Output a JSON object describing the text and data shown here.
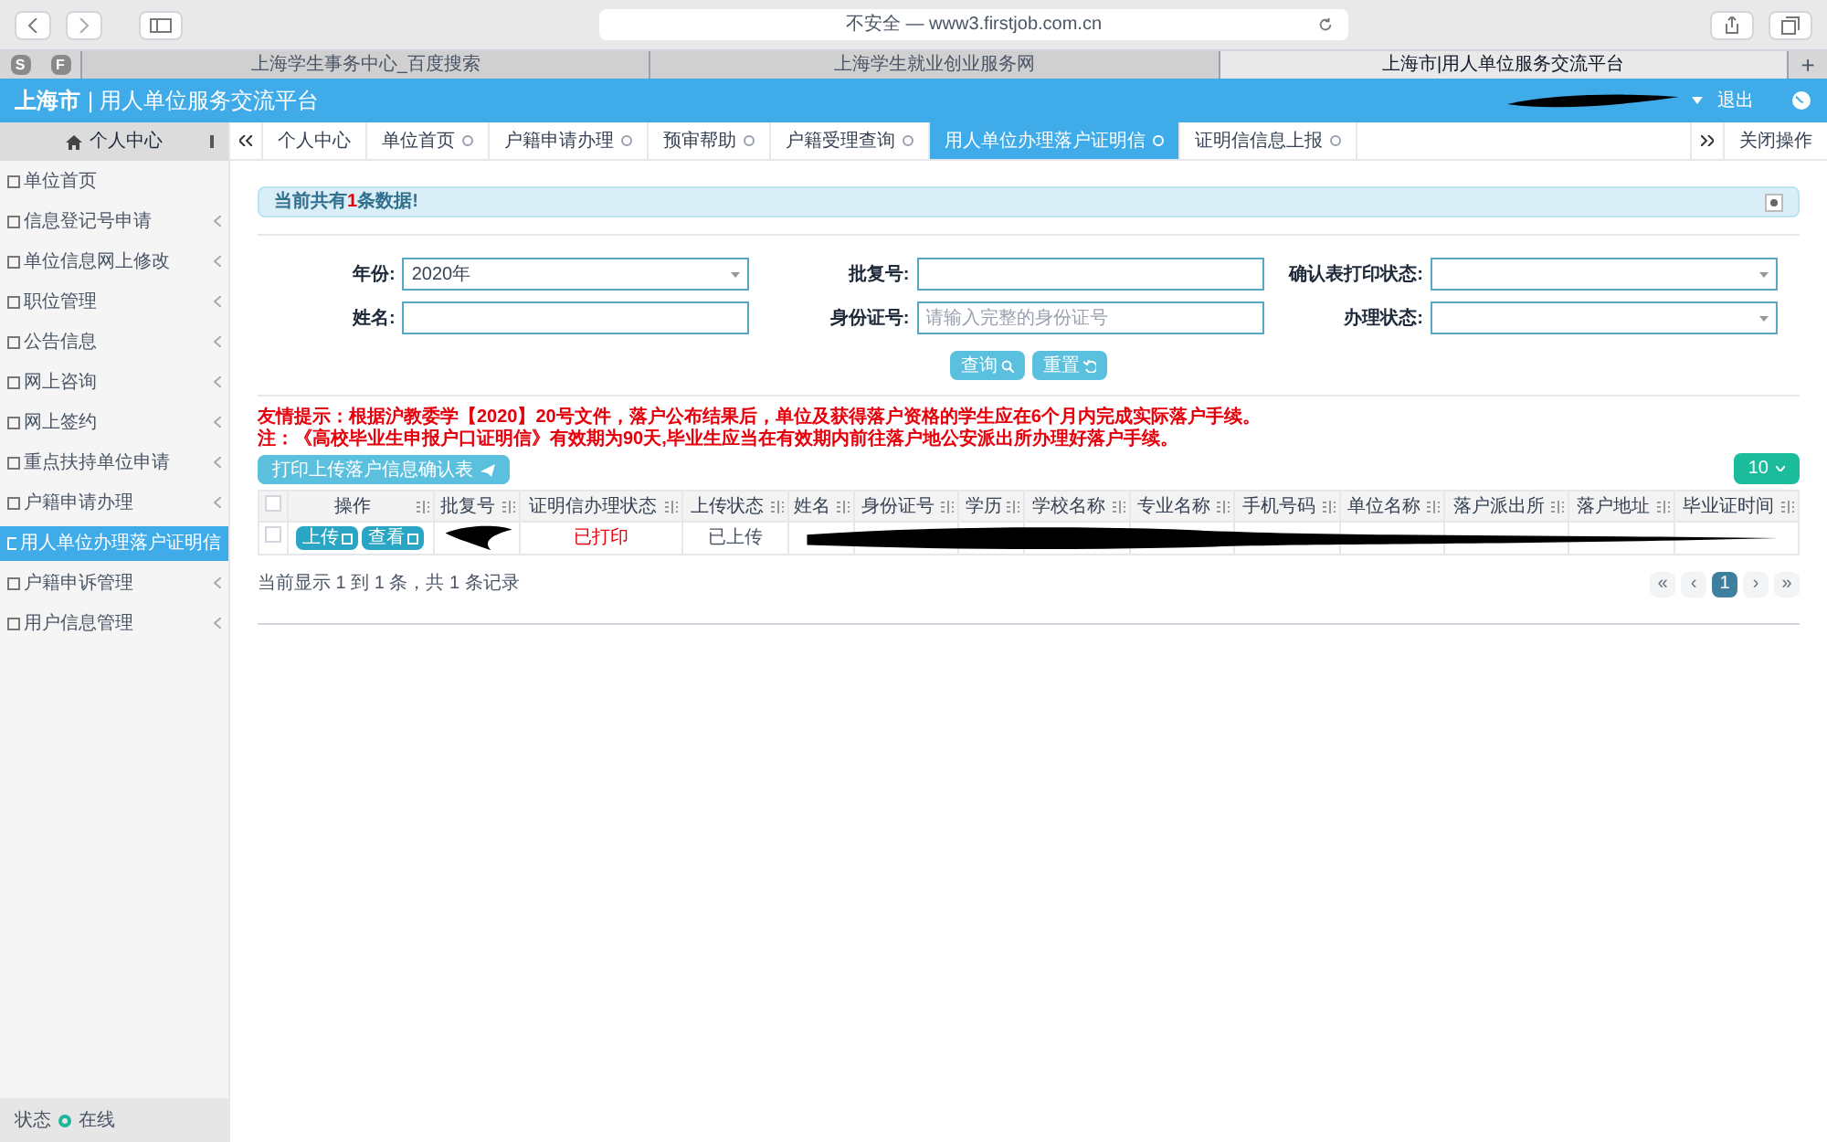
{
  "browser": {
    "address": "不安全 — www3.firstjob.com.cn",
    "pinned": [
      "S",
      "F"
    ],
    "tabs": [
      {
        "label": "上海学生事务中心_百度搜索",
        "selected": false
      },
      {
        "label": "上海学生就业创业服务网",
        "selected": false
      },
      {
        "label": "上海市|用人单位服务交流平台",
        "selected": true
      }
    ],
    "new_tab": "+"
  },
  "header": {
    "logo": "上海市",
    "title": "| 用人单位服务交流平台",
    "logout": "退出"
  },
  "sidebar": {
    "title": "个人中心",
    "items": [
      {
        "label": "单位首页",
        "expandable": false,
        "selected": false
      },
      {
        "label": "信息登记号申请",
        "expandable": true,
        "selected": false
      },
      {
        "label": "单位信息网上修改",
        "expandable": true,
        "selected": false
      },
      {
        "label": "职位管理",
        "expandable": true,
        "selected": false
      },
      {
        "label": "公告信息",
        "expandable": true,
        "selected": false
      },
      {
        "label": "网上咨询",
        "expandable": true,
        "selected": false
      },
      {
        "label": "网上签约",
        "expandable": true,
        "selected": false
      },
      {
        "label": "重点扶持单位申请",
        "expandable": true,
        "selected": false
      },
      {
        "label": "户籍申请办理",
        "expandable": true,
        "selected": false
      },
      {
        "label": "用人单位办理落户证明信",
        "expandable": false,
        "selected": true
      },
      {
        "label": "户籍申诉管理",
        "expandable": true,
        "selected": false
      },
      {
        "label": "用户信息管理",
        "expandable": true,
        "selected": false
      }
    ],
    "status_label": "状态",
    "status_value": "在线"
  },
  "page_tabs": [
    {
      "label": "个人中心",
      "closable": false,
      "selected": false
    },
    {
      "label": "单位首页",
      "closable": true,
      "selected": false
    },
    {
      "label": "户籍申请办理",
      "closable": true,
      "selected": false
    },
    {
      "label": "预审帮助",
      "closable": true,
      "selected": false
    },
    {
      "label": "户籍受理查询",
      "closable": true,
      "selected": false
    },
    {
      "label": "用人单位办理落户证明信",
      "closable": true,
      "selected": true
    },
    {
      "label": "证明信信息上报",
      "closable": true,
      "selected": false
    }
  ],
  "close_menu": "关闭操作",
  "alert": "当前共有**1**条数据!",
  "form": [
    {
      "label": "年份:",
      "kind": "select",
      "value": "2020年"
    },
    {
      "label": "批复号:",
      "kind": "text"
    },
    {
      "label": "确认表打印状态:",
      "kind": "select"
    },
    {
      "label": "姓名:",
      "kind": "text"
    },
    {
      "label": "身份证号:",
      "kind": "text",
      "placeholder": "请输入完整的身份证号"
    },
    {
      "label": "办理状态:",
      "kind": "select"
    }
  ],
  "buttons": [
    {
      "label": "查询",
      "kind": "search"
    },
    {
      "label": "重置",
      "kind": "reset"
    }
  ],
  "notices": [
    "友情提示：根据沪教委学【2020】20号文件，落户公布结果后，单位及获得落户资格的学生应在6个月内完成实际落户手续。",
    "注：《高校毕业生申报户口证明信》有效期为90天,毕业生应当在有效期内前往落户地公安派出所办理好落户手续。"
  ],
  "print_button": "打印上传落户信息确认表",
  "page_size": "10",
  "table": {
    "select_all": false,
    "columns": [
      "操作",
      "批复号",
      "证明信办理状态",
      "上传状态",
      "姓名",
      "身份证号",
      "学历",
      "学校名称",
      "专业名称",
      "手机号码",
      "单位名称",
      "落户派出所",
      "落户地址",
      "毕业证时间"
    ],
    "rows": [
      {
        "checked": false,
        "actions": [
          "上传",
          "查看"
        ],
        "print_status": "已打印",
        "upload_status": "已上传"
      }
    ]
  },
  "summary": "当前显示 1 到 1 条，共 1 条记录",
  "pagination": [
    {
      "label": "«",
      "selected": false
    },
    {
      "label": "‹",
      "selected": false
    },
    {
      "label": "1",
      "selected": true
    },
    {
      "label": "›",
      "selected": false
    },
    {
      "label": "»",
      "selected": false
    }
  ]
}
